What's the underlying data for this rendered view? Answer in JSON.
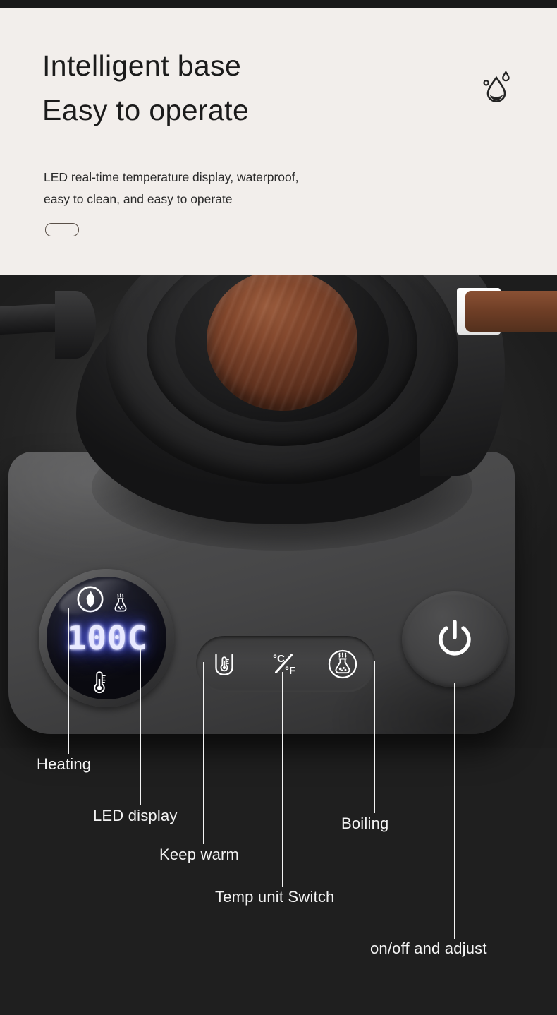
{
  "header": {
    "title_line_1": "Intelligent base",
    "title_line_2": "Easy to operate",
    "subtitle_line_1": "LED real-time temperature display, waterproof,",
    "subtitle_line_2": "easy to clean, and easy to operate",
    "badge_icon": "water-drop-icon",
    "background_color": "#f2eeeb",
    "text_color": "#1b1b1b"
  },
  "product": {
    "name": "electric kettle intelligent base",
    "background_color": "#1f1f1f",
    "base_color": "#464647",
    "wood_color": "#84482d"
  },
  "led_display": {
    "readout": "100C",
    "temperature_value": "100",
    "temperature_unit": "C",
    "glow_color": "#4a55ee",
    "digit_color": "#e8e9ff",
    "indicators": [
      {
        "name": "heating-flame-indicator",
        "icon": "flame-icon",
        "position": "top-left"
      },
      {
        "name": "boiling-indicator",
        "icon": "boiling-pot-icon",
        "position": "top-right"
      },
      {
        "name": "thermometer-indicator",
        "icon": "thermometer-icon",
        "position": "bottom-center"
      }
    ]
  },
  "controls": {
    "buttons": [
      {
        "name": "keep-warm-button",
        "icon": "cup-thermometer-icon",
        "label": "Keep warm"
      },
      {
        "name": "temp-unit-switch-button",
        "icon": "celsius-fahrenheit-icon",
        "label": "Temp unit Switch",
        "unit_primary": "°C",
        "unit_secondary": "°F"
      },
      {
        "name": "boiling-button",
        "icon": "boiling-pot-circle-icon",
        "label": "Boiling"
      }
    ],
    "power": {
      "name": "power-button",
      "icon": "power-icon",
      "label": "on/off and adjust"
    }
  },
  "callouts": [
    {
      "id": "heating",
      "label": "Heating"
    },
    {
      "id": "led",
      "label": "LED display"
    },
    {
      "id": "keepwarm",
      "label": "Keep warm"
    },
    {
      "id": "tempunit",
      "label": "Temp unit Switch"
    },
    {
      "id": "boiling",
      "label": "Boiling"
    },
    {
      "id": "power",
      "label": "on/off and adjust"
    }
  ]
}
